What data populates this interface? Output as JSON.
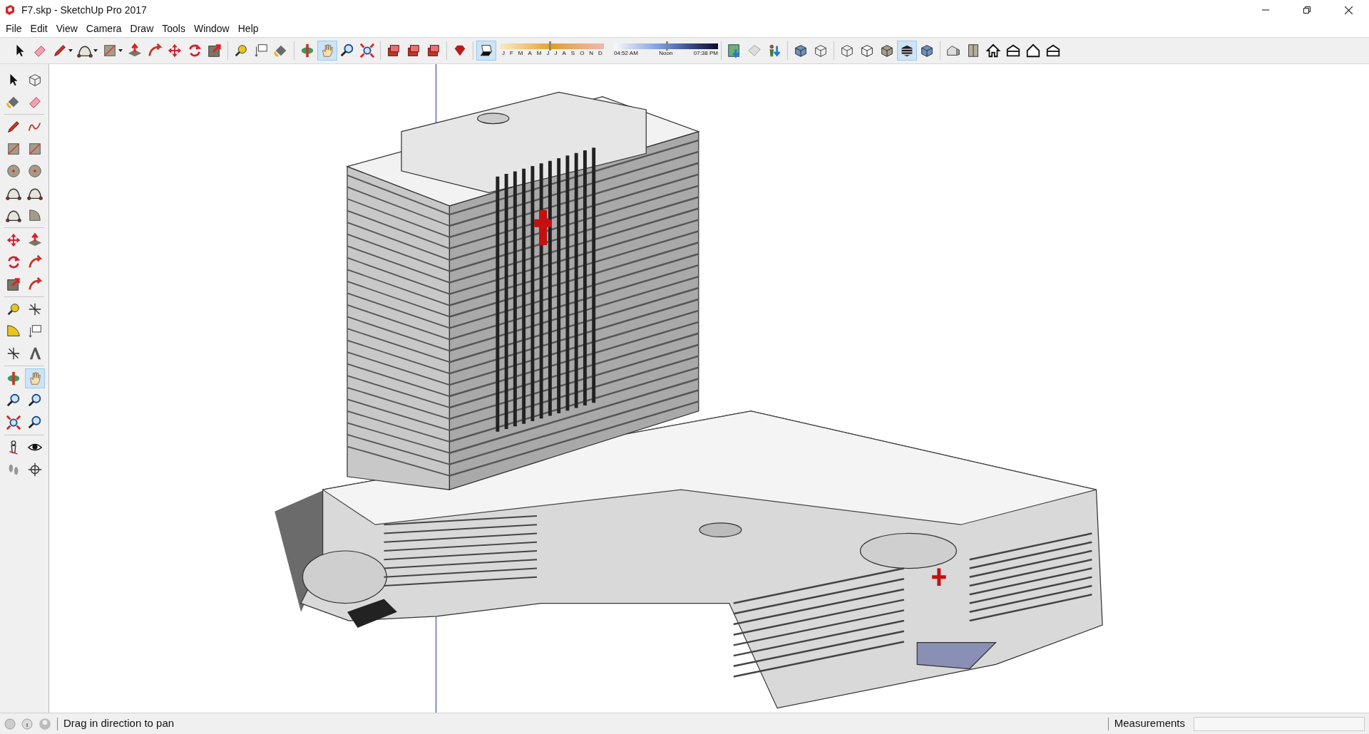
{
  "window": {
    "title": "F7.skp - SketchUp Pro 2017"
  },
  "menu": [
    "File",
    "Edit",
    "View",
    "Camera",
    "Draw",
    "Tools",
    "Window",
    "Help"
  ],
  "toolbar": {
    "groups": [
      [
        {
          "selected": false
        },
        {
          "selected": false
        },
        {
          "selected": false
        },
        {
          "selected": false
        },
        {
          "selected": false
        },
        {
          "selected": false
        },
        {
          "selected": false
        },
        {
          "selected": false
        },
        {
          "selected": false
        },
        {
          "selected": false
        }
      ],
      [
        {
          "selected": false
        },
        {
          "selected": false
        },
        {
          "selected": false
        }
      ],
      [
        {
          "selected": false
        },
        {
          "selected": true
        },
        {
          "selected": false
        },
        {
          "selected": false
        }
      ],
      [
        {
          "selected": false
        },
        {
          "selected": false
        },
        {
          "selected": false
        }
      ],
      [
        {
          "selected": false
        }
      ],
      [
        {
          "selected": true
        }
      ]
    ],
    "date_slider": {
      "months": [
        "J",
        "F",
        "M",
        "A",
        "M",
        "J",
        "J",
        "A",
        "S",
        "O",
        "N",
        "D"
      ],
      "level": 0.47
    },
    "time_slider": {
      "labels": [
        "04:52 AM",
        "Noon",
        "07:38 PM"
      ],
      "level": 0.5
    },
    "groups_right": [
      [
        {
          "selected": false
        },
        {
          "selected": false
        },
        {
          "selected": false
        }
      ],
      [
        {
          "selected": false
        },
        {
          "selected": false
        }
      ],
      [
        {
          "selected": false
        },
        {
          "selected": false
        },
        {
          "selected": false
        },
        {
          "selected": true
        },
        {
          "selected": false
        }
      ],
      [
        {
          "selected": false
        },
        {
          "selected": false
        },
        {
          "selected": false
        },
        {
          "selected": false
        },
        {
          "selected": false
        },
        {
          "selected": false
        }
      ]
    ]
  },
  "left_toolbar": [
    [
      {
        "selected": false
      },
      {
        "selected": false
      },
      {
        "selected": false
      },
      {
        "selected": false
      }
    ],
    [
      {
        "selected": false
      },
      {
        "selected": false
      },
      {
        "selected": false
      },
      {
        "selected": false
      },
      {
        "selected": false
      },
      {
        "selected": false
      },
      {
        "selected": false
      },
      {
        "selected": false
      },
      {
        "selected": false
      },
      {
        "selected": false
      }
    ],
    [
      {
        "selected": false
      },
      {
        "selected": false
      },
      {
        "selected": false
      },
      {
        "selected": false
      },
      {
        "selected": false
      },
      {
        "selected": false
      }
    ],
    [
      {
        "selected": false
      },
      {
        "selected": false
      },
      {
        "selected": false
      },
      {
        "selected": false
      },
      {
        "selected": false
      },
      {
        "selected": false
      }
    ],
    [
      {
        "selected": false
      },
      {
        "selected": true
      },
      {
        "selected": false
      },
      {
        "selected": false
      },
      {
        "selected": false
      },
      {
        "selected": false
      }
    ],
    [
      {
        "selected": false
      },
      {
        "selected": false
      },
      {
        "selected": false
      },
      {
        "selected": false
      }
    ]
  ],
  "status_bar": {
    "message": "Drag in direction to pan",
    "measurements_label": "Measurements"
  }
}
